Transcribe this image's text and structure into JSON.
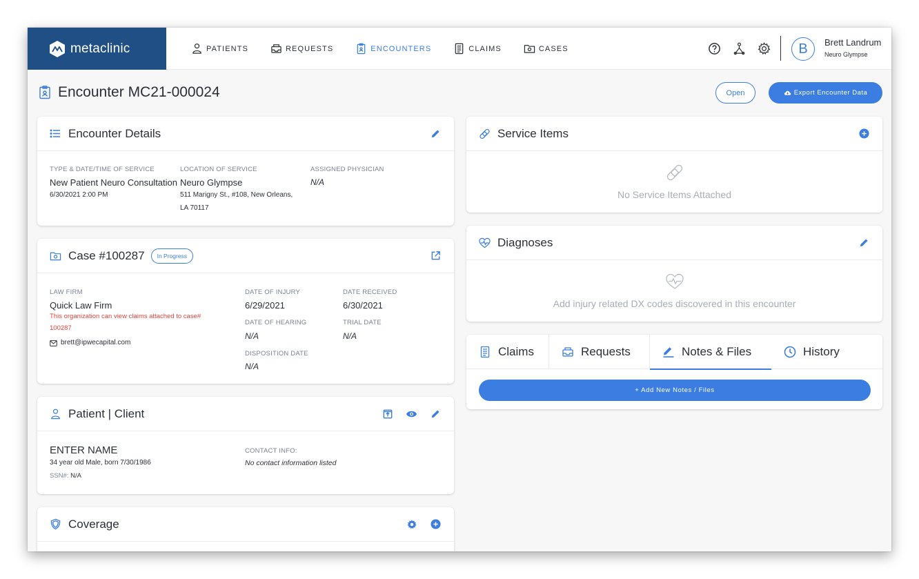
{
  "brand": {
    "name": "metaclinic"
  },
  "nav": {
    "items": [
      {
        "label": "PATIENTS",
        "icon": "patient-icon"
      },
      {
        "label": "REQUESTS",
        "icon": "inbox-icon"
      },
      {
        "label": "ENCOUNTERS",
        "icon": "clipboard-icon",
        "active": true
      },
      {
        "label": "CLAIMS",
        "icon": "document-icon"
      },
      {
        "label": "CASES",
        "icon": "folder-icon"
      }
    ]
  },
  "user": {
    "initial": "B",
    "name": "Brett Landrum",
    "org": "Neuro Glympse"
  },
  "page": {
    "title": "Encounter MC21-000024",
    "open_label": "Open",
    "export_label": "Export Encounter Data"
  },
  "encounter_details": {
    "title": "Encounter Details",
    "type_label": "TYPE & DATE/TIME OF SERVICE",
    "type_value": "New Patient Neuro Consultation",
    "type_datetime": "6/30/2021 2:00 PM",
    "location_label": "LOCATION OF SERVICE",
    "location_name": "Neuro Glympse",
    "location_address_1": "511 Marigny St., #108, New Orleans,",
    "location_address_2": "LA 70117",
    "physician_label": "ASSIGNED PHYSICIAN",
    "physician_value": "N/A"
  },
  "case": {
    "title": "Case #100287",
    "status": "In Progress",
    "law_firm_label": "LAW FIRM",
    "law_firm_value": "Quick Law Firm",
    "warning_1": "This organization can view claims attached to case#",
    "warning_2": "100287",
    "email": "brett@ipwecapital.com",
    "injury_label": "DATE OF INJURY",
    "injury_value": "6/29/2021",
    "received_label": "DATE RECEIVED",
    "received_value": "6/30/2021",
    "hearing_label": "DATE OF HEARING",
    "hearing_value": "N/A",
    "trial_label": "TRIAL DATE",
    "trial_value": "N/A",
    "disposition_label": "DISPOSITION DATE",
    "disposition_value": "N/A"
  },
  "patient": {
    "title": "Patient | Client",
    "name": "ENTER NAME",
    "description": "34 year old Male, born 7/30/1986",
    "ssn_label": "SSN#:",
    "ssn_value": "N/A",
    "contact_label": "CONTACT INFO:",
    "contact_value": "No contact information listed"
  },
  "coverage": {
    "title": "Coverage"
  },
  "service_items": {
    "title": "Service Items",
    "empty": "No Service Items Attached"
  },
  "diagnoses": {
    "title": "Diagnoses",
    "empty": "Add injury related DX codes discovered in this encounter"
  },
  "tabs": {
    "items": [
      {
        "label": "Claims",
        "icon": "document-icon"
      },
      {
        "label": "Requests",
        "icon": "inbox-icon"
      },
      {
        "label": "Notes & Files",
        "icon": "pencil-icon",
        "active": true
      },
      {
        "label": "History",
        "icon": "clock-icon"
      }
    ],
    "add_label": "+ Add New Notes / Files"
  },
  "colors": {
    "brand": "#1f4f84",
    "accent": "#3b7de0",
    "warning": "#e2453c"
  }
}
